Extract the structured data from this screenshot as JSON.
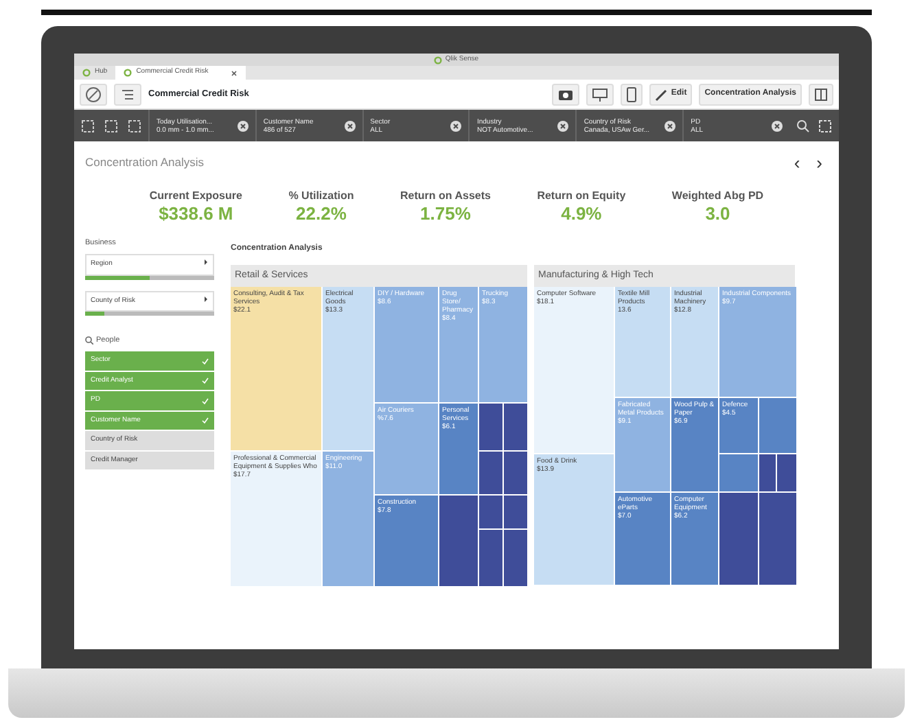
{
  "window": {
    "title": "Qlik Sense"
  },
  "tabs": [
    {
      "label": "Hub",
      "selected": false,
      "closable": false
    },
    {
      "label": "Commercial Credit Risk",
      "selected": true,
      "closable": true
    }
  ],
  "toolbar": {
    "app_title": "Commercial Credit Risk",
    "edit_label": "Edit",
    "sheet_name": "Concentration Analysis"
  },
  "filters": [
    {
      "field": "Today Utilisation...",
      "value": "0.0 mm - 1.0 mm..."
    },
    {
      "field": "Customer Name",
      "value": "486 of 527"
    },
    {
      "field": "Sector",
      "value": "ALL"
    },
    {
      "field": "Industry",
      "value": "NOT Automotive..."
    },
    {
      "field": "Country of Risk",
      "value": "Canada, USAw Ger..."
    },
    {
      "field": "PD",
      "value": "ALL"
    }
  ],
  "sheet": {
    "title": "Concentration Analysis",
    "prev": "‹",
    "next": "›"
  },
  "kpis": [
    {
      "label": "Current Exposure",
      "value": "$338.6 M"
    },
    {
      "label": "% Utilization",
      "value": "22.2%"
    },
    {
      "label": "Return on Assets",
      "value": "1.75%"
    },
    {
      "label": "Return on Equity",
      "value": "4.9%"
    },
    {
      "label": "Weighted Abg PD",
      "value": "3.0"
    }
  ],
  "sidebar": {
    "business_label": "Business",
    "dropdowns": [
      {
        "label": "Region",
        "level": 0.5
      },
      {
        "label": "County of Risk",
        "level": 0.15
      }
    ],
    "people_label": "People",
    "people": [
      {
        "label": "Sector",
        "checked": true
      },
      {
        "label": "Credit Analyst",
        "checked": true
      },
      {
        "label": "PD",
        "checked": true
      },
      {
        "label": "Customer Name",
        "checked": true
      },
      {
        "label": "Country of Risk",
        "checked": false
      },
      {
        "label": "Credit Manager",
        "checked": false
      }
    ]
  },
  "treemap": {
    "title": "Concentration Analysis",
    "groups": [
      {
        "name": "Retail & Services",
        "tiles": [
          {
            "name": "Consulting, Audit & Tax Services",
            "value": "$22.1",
            "color": "#f5e0a6"
          },
          {
            "name": "Electrical Goods",
            "value": "$13.3",
            "color": "#c6ddf3"
          },
          {
            "name": "DIY / Hardware",
            "value": "$8.6",
            "color": "#8fb3e1"
          },
          {
            "name": "Drug Store/ Pharmacy",
            "value": "$8.4",
            "color": "#8fb3e1"
          },
          {
            "name": "Trucking",
            "value": "$8.3",
            "color": "#8fb3e1"
          },
          {
            "name": "Air Couriers",
            "value": "%7.6",
            "color": "#8fb3e1"
          },
          {
            "name": "Personal Services",
            "value": "$6.1",
            "color": "#5884c4"
          },
          {
            "name": "Professional & Commercial Equipment & Supplies Who",
            "value": "$17.7",
            "color": "#eaf3fb"
          },
          {
            "name": "Engineering",
            "value": "$11.0",
            "color": "#8fb3e1"
          },
          {
            "name": "Construction",
            "value": "$7.8",
            "color": "#5884c4"
          }
        ]
      },
      {
        "name": "Manufacturing & High Tech",
        "tiles": [
          {
            "name": "Computer Software",
            "value": "$18.1",
            "color": "#eaf3fb"
          },
          {
            "name": "Textile Mill Products",
            "value": "13.6",
            "color": "#c6ddf3"
          },
          {
            "name": "Industrial Machinery",
            "value": "$12.8",
            "color": "#c6ddf3"
          },
          {
            "name": "Industrial Components",
            "value": "$9.7",
            "color": "#8fb3e1"
          },
          {
            "name": "Fabricated Metal Products",
            "value": "$9.1",
            "color": "#8fb3e1"
          },
          {
            "name": "Wood Pulp & Paper",
            "value": "$6.9",
            "color": "#5884c4"
          },
          {
            "name": "Defence",
            "value": "$4.5",
            "color": "#5884c4"
          },
          {
            "name": "Food & Drink",
            "value": "$13.9",
            "color": "#c6ddf3"
          },
          {
            "name": "Automotive eParts",
            "value": "$7.0",
            "color": "#5884c4"
          },
          {
            "name": "Computer Equipment",
            "value": "$6.2",
            "color": "#5884c4"
          }
        ]
      }
    ]
  }
}
